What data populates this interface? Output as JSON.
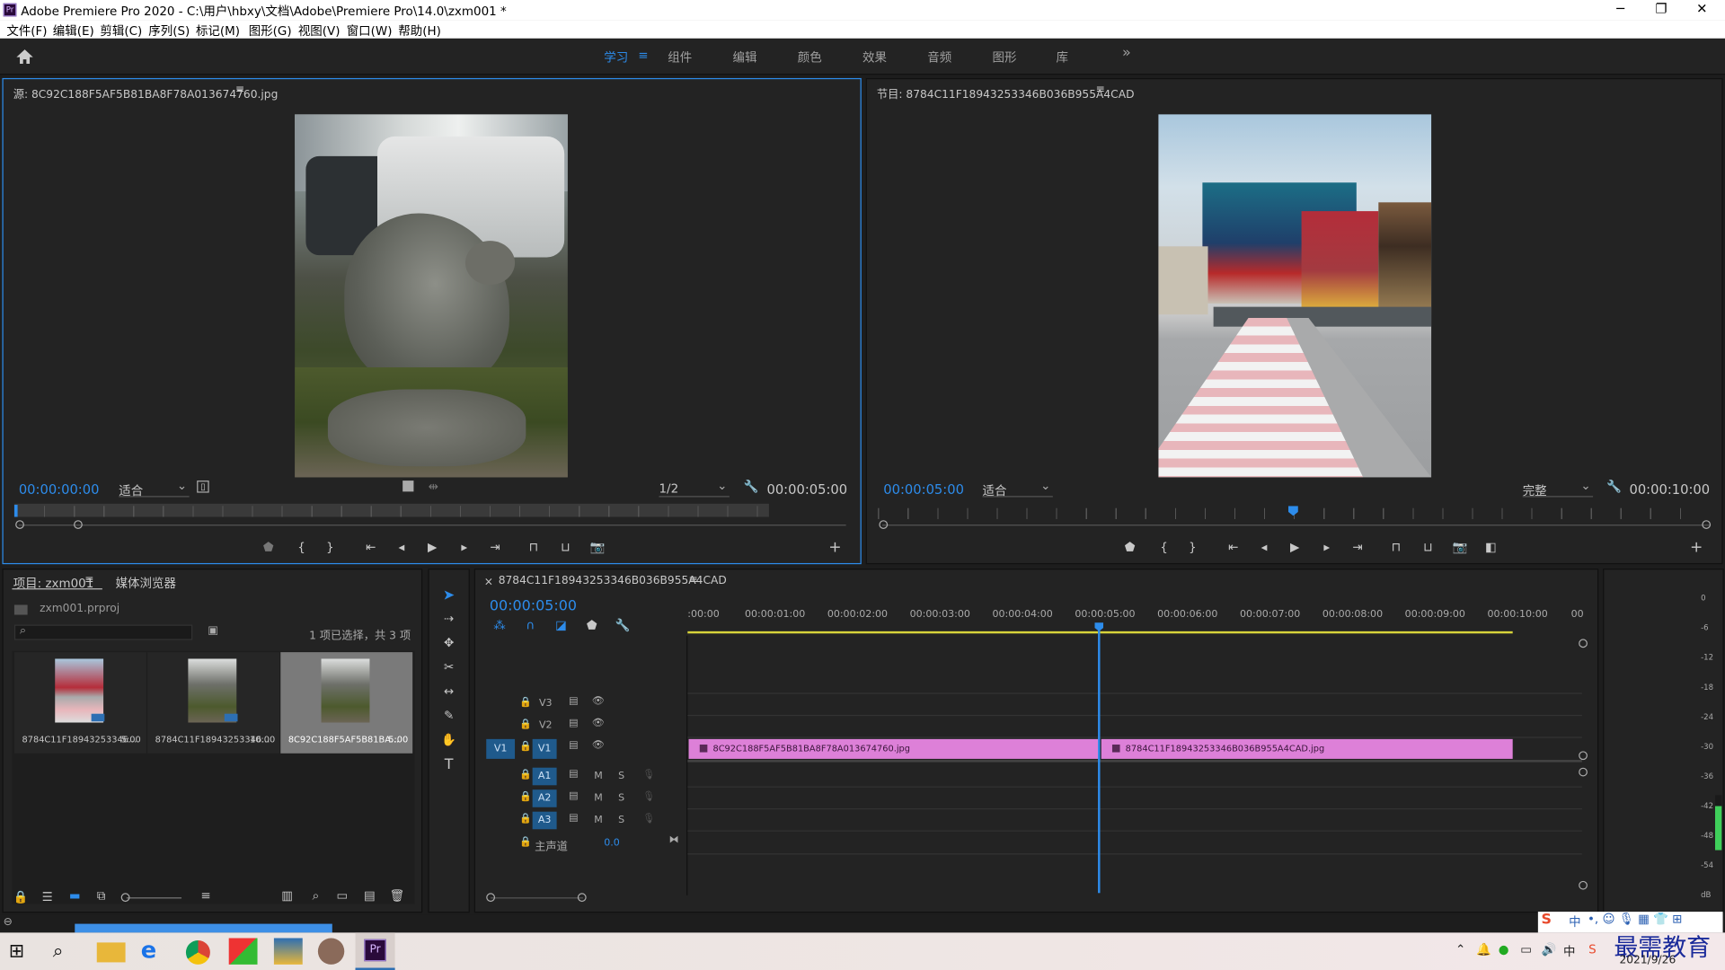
{
  "window": {
    "title": "Adobe Premiere Pro 2020 - C:\\用户\\hbxy\\文档\\Adobe\\Premiere Pro\\14.0\\zxm001 *",
    "logo": "Pr"
  },
  "menu": [
    "文件(F)",
    "编辑(E)",
    "剪辑(C)",
    "序列(S)",
    "标记(M)",
    "图形(G)",
    "视图(V)",
    "窗口(W)",
    "帮助(H)"
  ],
  "workspaces": {
    "items": [
      "学习",
      "组件",
      "编辑",
      "颜色",
      "效果",
      "音频",
      "图形",
      "库"
    ],
    "active": "学习",
    "more": "»"
  },
  "source": {
    "title": "源: 8C92C188F5AF5B81BA8F78A013674760.jpg",
    "timecode": "00:00:00:00",
    "fit": "适合",
    "resolution": "1/2",
    "duration": "00:00:05:00"
  },
  "program": {
    "title": "节目: 8784C11F18943253346B036B955A4CAD",
    "timecode": "00:00:05:00",
    "fit": "适合",
    "quality": "完整",
    "duration": "00:00:10:00"
  },
  "project": {
    "tab1": "项目: zxm001",
    "tab2": "媒体浏览器",
    "file": "zxm001.prproj",
    "selection": "1 项已选择，共 3 项",
    "items": [
      {
        "name": "8784C11F18943253346...",
        "dur": "5:00"
      },
      {
        "name": "8784C11F18943253346...",
        "dur": "10:00"
      },
      {
        "name": "8C92C188F5AF5B81BA...",
        "dur": "5:00"
      }
    ]
  },
  "timeline": {
    "tab": "8784C11F18943253346B036B955A4CAD",
    "timecode": "00:00:05:00",
    "ruler": [
      ":00:00",
      "00:00:01:00",
      "00:00:02:00",
      "00:00:03:00",
      "00:00:04:00",
      "00:00:05:00",
      "00:00:06:00",
      "00:00:07:00",
      "00:00:08:00",
      "00:00:09:00",
      "00:00:10:00",
      "00"
    ],
    "video_tracks": [
      "V3",
      "V2",
      "V1"
    ],
    "audio_tracks": [
      "A1",
      "A2",
      "A3"
    ],
    "source_patch": "V1",
    "mute": "M",
    "solo": "S",
    "master": "主声道",
    "master_vol": "0.0",
    "clips": [
      "8C92C188F5AF5B81BA8F78A013674760.jpg",
      "8784C11F18943253346B036B955A4CAD.jpg"
    ]
  },
  "meter": {
    "scale": [
      "0",
      "-6",
      "-12",
      "-18",
      "-24",
      "-30",
      "-36",
      "-42",
      "-48",
      "-54",
      "dB"
    ]
  },
  "taskbar": {
    "date": "2021/9/26",
    "watermark": "最需教育",
    "ime": "中"
  }
}
